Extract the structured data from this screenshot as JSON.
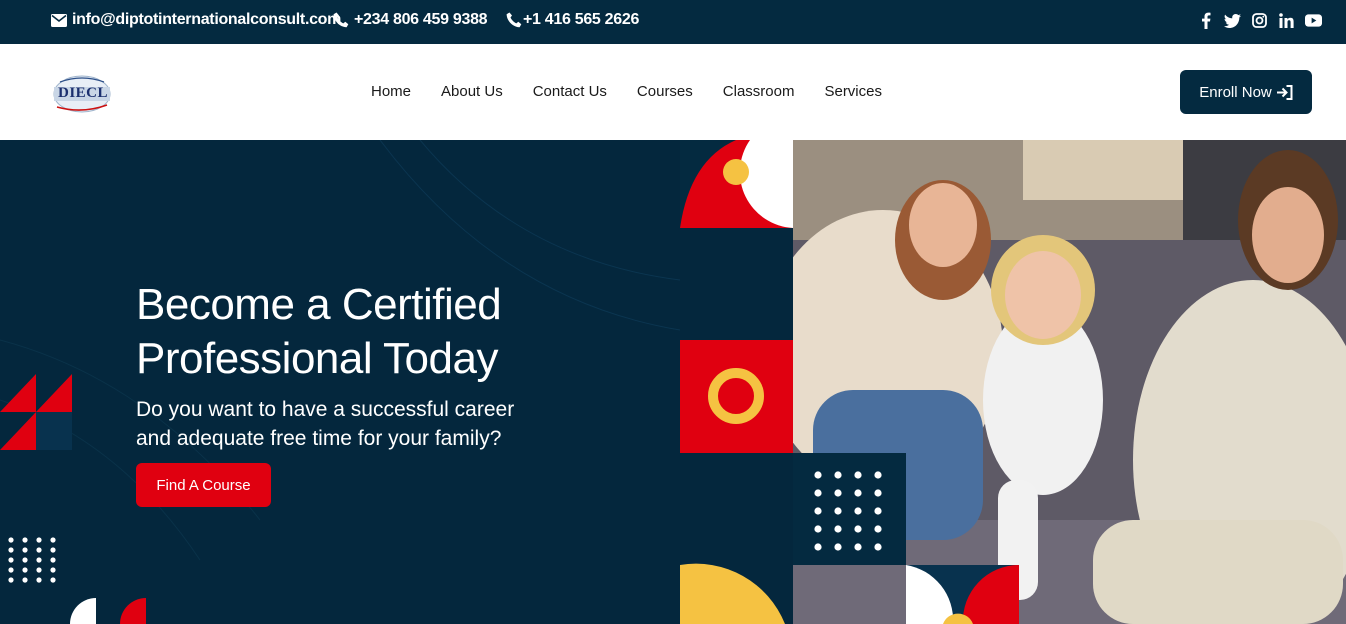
{
  "topbar": {
    "email": "info@diptotinternationalconsult.com",
    "phone1": "+234 806 459 9388",
    "phone2": "+1 416 565 2626",
    "social": [
      "facebook-icon",
      "twitter-icon",
      "instagram-icon",
      "linkedin-icon",
      "youtube-icon"
    ]
  },
  "navbar": {
    "logo_text": "DIECL",
    "links": [
      "Home",
      "About Us",
      "Contact Us",
      "Courses",
      "Classroom",
      "Services"
    ],
    "enroll_label": "Enroll Now"
  },
  "hero": {
    "title_line1": "Become a Certified",
    "title_line2": "Professional Today",
    "subtitle_line1": "Do you want to have a successful career",
    "subtitle_line2": "and adequate free time for your family?",
    "cta_label": "Find A Course"
  },
  "colors": {
    "navy": "#042a40",
    "red": "#e00010",
    "yellow": "#f5c242"
  }
}
